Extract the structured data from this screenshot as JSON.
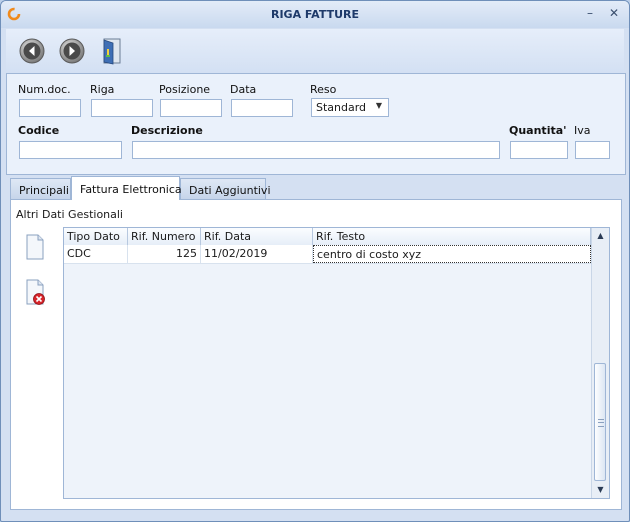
{
  "window": {
    "title": "RIGA FATTURE"
  },
  "titlebar": {
    "minimize_icon": "minimize-icon",
    "close_icon": "close-icon"
  },
  "toolbar": {
    "buttons": [
      "previous-arrow-icon",
      "next-arrow-icon",
      "exit-door-icon"
    ]
  },
  "form": {
    "num_doc_label": "Num.doc.",
    "riga_label": "Riga",
    "posizione_label": "Posizione",
    "data_label": "Data",
    "reso_label": "Reso",
    "reso_value": "Standard",
    "codice_label": "Codice",
    "descrizione_label": "Descrizione",
    "quantita_label": "Quantita'",
    "iva_label": "Iva",
    "num_doc_value": "",
    "riga_value": "",
    "posizione_value": "",
    "data_value": "",
    "codice_value": "",
    "descrizione_value": "",
    "quantita_value": "",
    "iva_value": ""
  },
  "tabs": [
    {
      "label": "Principali",
      "active": false
    },
    {
      "label": "Fattura Elettronica",
      "active": true
    },
    {
      "label": "Dati Aggiuntivi",
      "active": false
    }
  ],
  "panel": {
    "section_title": "Altri Dati Gestionali",
    "columns": [
      "Tipo Dato",
      "Rif. Numero",
      "Rif. Data",
      "Rif. Testo"
    ],
    "rows": [
      {
        "tipo_dato": "CDC",
        "rif_numero": "125",
        "rif_data": "11/02/2019",
        "rif_testo": "centro di costo xyz"
      }
    ]
  },
  "colors": {
    "accent": "#1e3a6a",
    "frame": "#9fb6d6",
    "panel": "#eaf1fb"
  }
}
